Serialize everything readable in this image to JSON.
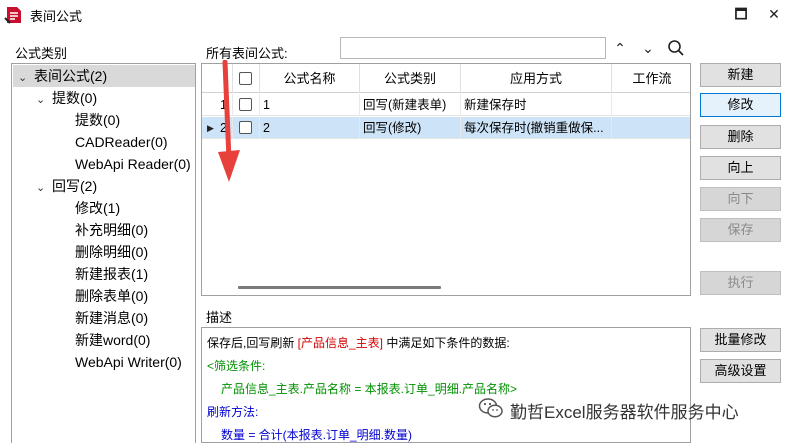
{
  "window": {
    "title": "表间公式",
    "minimize_glyph": "🗖",
    "close_glyph": "✕"
  },
  "sidebar": {
    "label": "公式类别",
    "nodes": [
      {
        "label": "表间公式(2)",
        "caret": "⌄",
        "selected": true
      },
      {
        "label": "提数(0)",
        "caret": "⌄"
      },
      {
        "label": "提数(0)"
      },
      {
        "label": "CADReader(0)"
      },
      {
        "label": "WebApi Reader(0)"
      },
      {
        "label": "回写(2)",
        "caret": "⌄"
      },
      {
        "label": "修改(1)"
      },
      {
        "label": "补充明细(0)"
      },
      {
        "label": "删除明细(0)"
      },
      {
        "label": "新建报表(1)"
      },
      {
        "label": "删除表单(0)"
      },
      {
        "label": "新建消息(0)"
      },
      {
        "label": "新建word(0)"
      },
      {
        "label": "WebApi Writer(0)"
      }
    ]
  },
  "search": {
    "label": "所有表间公式:",
    "value": "",
    "up_glyph": "⌃",
    "down_glyph": "⌄",
    "search_glyph": "⚲"
  },
  "grid": {
    "columns": [
      "公式名称",
      "公式类别",
      "应用方式",
      "工作流"
    ],
    "rows": [
      {
        "index": "1",
        "name": "1",
        "category": "回写(新建表单)",
        "mode": "新建保存时",
        "workflow": "",
        "selected": false
      },
      {
        "index": "2",
        "name": "2",
        "category": "回写(修改)",
        "mode": "每次保存时(撤销重做保...",
        "workflow": "",
        "selected": true
      }
    ],
    "row_pointer": "▶"
  },
  "description": {
    "label": "描述",
    "line1_prefix": "保存后,回写刷新 ",
    "line1_highlight": "[产品信息_主表]",
    "line1_suffix": " 中满足如下条件的数据:",
    "filter_title": "<筛选条件:",
    "filter_expr": "产品信息_主表.产品名称 = 本报表.订单_明细.产品名称>",
    "refresh_title": "刷新方法:",
    "refresh_expr": "数量 = 合计(本报表.订单_明细.数量)"
  },
  "buttons": {
    "new": "新建",
    "edit": "修改",
    "delete": "删除",
    "up": "向上",
    "down": "向下",
    "save": "保存",
    "run": "执行",
    "batch_edit": "批量修改",
    "advanced": "高级设置"
  },
  "watermark": {
    "text": "勤哲Excel服务器软件服务中心"
  },
  "colors": {
    "selected_row": "#cde3f7",
    "highlight_red": "#d40000",
    "annotation_arrow": "#e8413c",
    "keyword_green": "#009000",
    "keyword_blue": "#0000d0"
  }
}
